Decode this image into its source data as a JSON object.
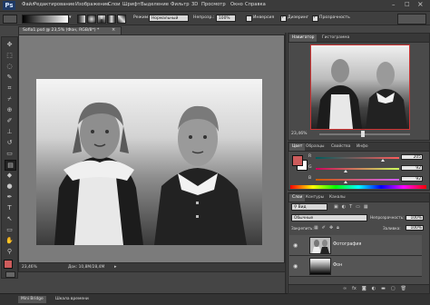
{
  "app": {
    "logo": "Ps"
  },
  "menu": [
    "Файл",
    "Редактирование",
    "Изображение",
    "Слои",
    "Шрифт",
    "Выделение",
    "Фильтр",
    "3D",
    "Просмотр",
    "Окно",
    "Справка"
  ],
  "options": {
    "mode_label": "Режим:",
    "mode_value": "Нормальный",
    "opacity_label": "Непрозр.:",
    "opacity_value": "100%",
    "invert_label": "Инверсия",
    "dither_label": "Дизеринг",
    "transparency_label": "Прозрачность"
  },
  "document": {
    "tab_title": "Sofia1.psd @ 23,5% (Фон, RGB/8*) *",
    "tab_close": "×",
    "zoom": "23,46%",
    "doc_info": "Док: 10,8M/28,4M"
  },
  "navigator": {
    "tabs": [
      "Навигатор",
      "Гистограмма"
    ],
    "zoom": "23,46%"
  },
  "color": {
    "tabs": [
      "Цвет",
      "Образцы",
      "Свойства",
      "Инфо"
    ],
    "channels": [
      {
        "label": "R",
        "value": "205",
        "level": 0.8
      },
      {
        "label": "G",
        "value": "92",
        "level": 0.36
      },
      {
        "label": "B",
        "value": "92",
        "level": 0.36
      }
    ],
    "fg_color": "#cd5c5c",
    "bg_color": "#ffffff"
  },
  "layers": {
    "tabs": [
      "Слои",
      "Контуры",
      "Каналы"
    ],
    "kind_label": "Вид",
    "blend_mode": "Обычные",
    "opacity_label": "Непрозрачность:",
    "opacity_value": "100%",
    "lock_label": "Закрепить:",
    "fill_label": "Заливка:",
    "fill_value": "100%",
    "items": [
      {
        "name": "Фотография",
        "visible": true
      },
      {
        "name": "Фон",
        "visible": true
      }
    ]
  },
  "bottom_tabs": [
    "Mini Bridge",
    "Шкала времени"
  ]
}
